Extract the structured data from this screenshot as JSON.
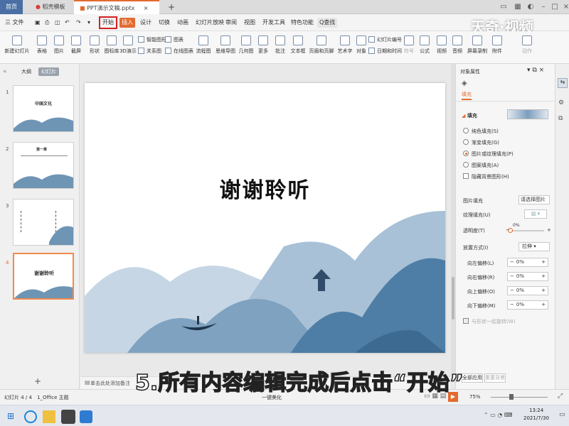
{
  "tabs": {
    "home": "首页",
    "template": "稻壳模板",
    "doc": "PPT演示文稿.pptx",
    "add": "+"
  },
  "menu": {
    "file": "三 文件",
    "start": "开始",
    "insert": "插入",
    "design": "设计",
    "switch": "切换",
    "animation": "动画",
    "slideshow": "幻灯片放映",
    "review": "审阅",
    "view": "视图",
    "devtools": "开发工具",
    "special": "特色功能",
    "search": "Q查找"
  },
  "ribbon": {
    "new_slide": "新建幻灯片",
    "table": "表格",
    "picture": "图片",
    "screenshot": "截屏",
    "shape": "形状",
    "iconlib": "图标库",
    "3d": "3D演示",
    "smart": "智能图形",
    "chart": "图表",
    "relation": "关系图",
    "online_chart": "在线图表",
    "flow": "流程图",
    "mind": "思维导图",
    "geo": "几何图",
    "more": "更多",
    "comment": "批注",
    "textbox": "文本框",
    "header": "页眉和页脚",
    "art": "艺术字",
    "object": "对象",
    "slide_no": "幻灯片编号",
    "datetime": "日期和时间",
    "symbol": "符号",
    "formula": "公式",
    "video": "视频",
    "audio": "音频",
    "screen_rec": "屏幕录制",
    "attach": "附件",
    "action": "动作"
  },
  "left": {
    "outline": "大纲",
    "slides": "幻灯片"
  },
  "thumbs": [
    {
      "num": "1",
      "text": "中国文化"
    },
    {
      "num": "2",
      "text": "第一章"
    },
    {
      "num": "3",
      "text": ""
    },
    {
      "num": "4",
      "text": "谢谢聆听"
    }
  ],
  "slide": {
    "title": "谢谢聆听"
  },
  "notes": "单击此处添加备注",
  "right": {
    "panel_title": "对象属性",
    "fill_tab": "填充",
    "fill_header": "填充",
    "opt1": "纯色填充(S)",
    "opt2": "渐变填充(G)",
    "opt3": "图片或纹理填充(P)",
    "opt4": "图案填充(A)",
    "hide_bg": "隐藏背景图形(H)",
    "pic_fill": "图片填充",
    "pic_fill_val": "请选择图片",
    "texture": "纹理填充(U)",
    "transparency": "透明度(T)",
    "trans_val": "0%",
    "placement": "放置方式(I)",
    "placement_val": "拉伸",
    "offset_left": "向左偏移(L)",
    "offset_right": "向右偏移(R)",
    "offset_up": "向上偏移(O)",
    "offset_down": "向下偏移(M)",
    "offset_val": "0%",
    "rotate": "与形状一起旋转(W)",
    "apply_all": "全部应用",
    "reset_bg": "重置背景"
  },
  "status": {
    "slide_info": "幻灯片 4 / 4",
    "theme": "1_Office 主题",
    "beautify": "一键美化",
    "zoom": "75%"
  },
  "taskbar": {
    "time": "13:24",
    "date": "2021/7/30"
  },
  "subtitle": "5.所有内容编辑完成后点击“开始”",
  "watermark": "天奇·视频",
  "colors": {
    "accent": "#e36b2f",
    "highlight": "#d42020",
    "mountain": "#4e7ea6"
  }
}
